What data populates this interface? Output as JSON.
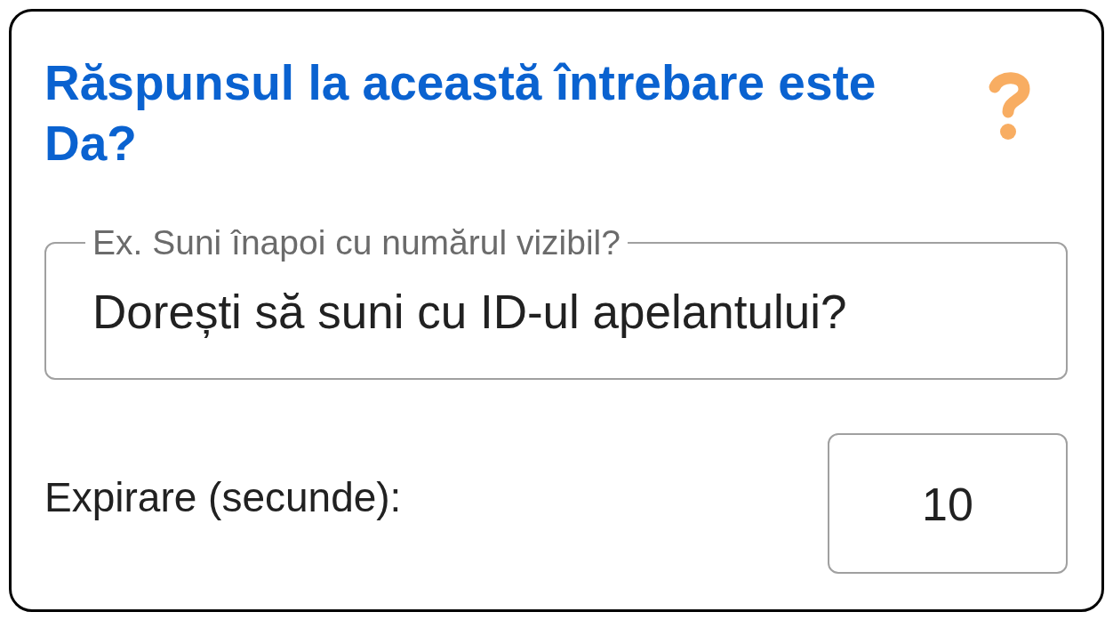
{
  "dialog": {
    "title": "Răspunsul la această întrebare este Da?"
  },
  "question_field": {
    "label": "Ex. Suni înapoi cu numărul vizibil?",
    "value": "Dorești să suni cu ID-ul apelantului?"
  },
  "timeout": {
    "label": "Expirare (secunde):",
    "value": "10"
  }
}
